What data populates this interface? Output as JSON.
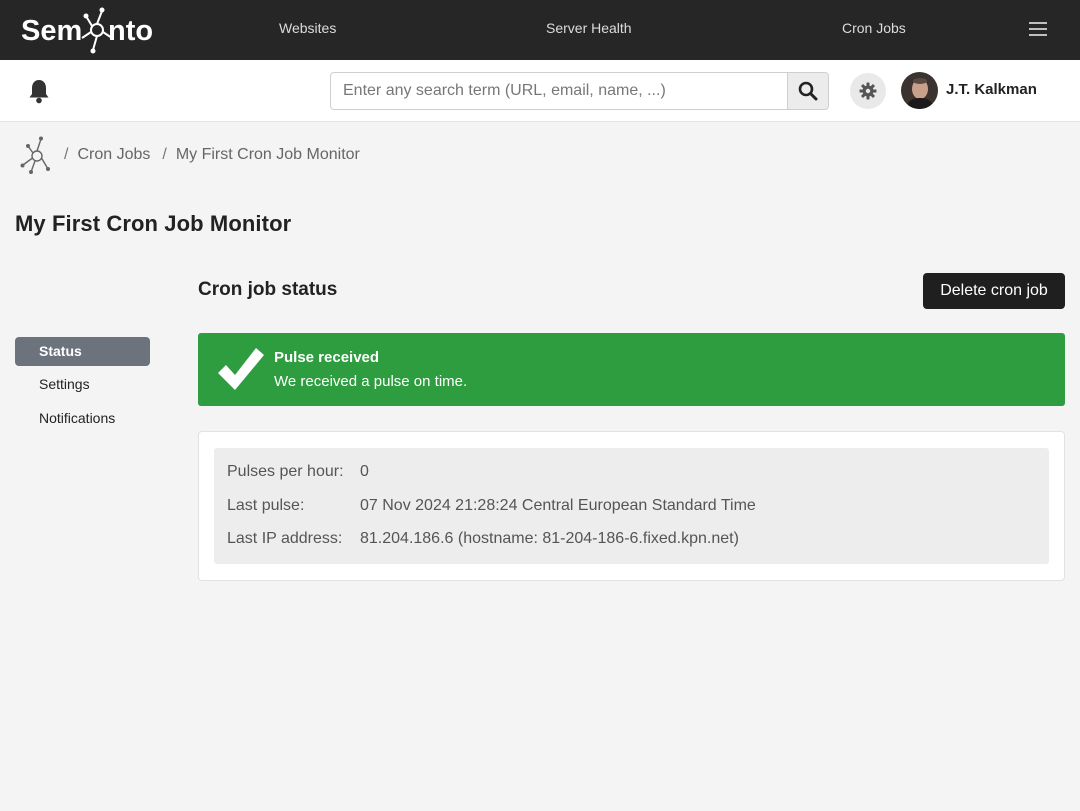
{
  "app": {
    "brand": "Semonto"
  },
  "topnav": {
    "items": [
      {
        "label": "Websites"
      },
      {
        "label": "Server Health"
      },
      {
        "label": "Cron Jobs"
      }
    ]
  },
  "header": {
    "search_placeholder": "Enter any search term (URL, email, name, ...)",
    "search_value": "",
    "user_name": "J.T. Kalkman"
  },
  "breadcrumb": {
    "separator": "/",
    "items": [
      "Cron Jobs",
      "My First Cron Job Monitor"
    ]
  },
  "page": {
    "title": "My First Cron Job Monitor"
  },
  "sidebar": {
    "items": [
      {
        "label": "Status",
        "active": true
      },
      {
        "label": "Settings",
        "active": false
      },
      {
        "label": "Notifications",
        "active": false
      }
    ]
  },
  "main": {
    "section_title": "Cron job status",
    "delete_label": "Delete cron job",
    "alert": {
      "title": "Pulse received",
      "text": "We received a pulse on time.",
      "color": "#2e9d3f",
      "icon": "checkmark-icon"
    },
    "details": [
      {
        "label": "Pulses per hour:",
        "value": "0"
      },
      {
        "label": "Last pulse:",
        "value": "07 Nov 2024 21:28:24 Central European Standard Time"
      },
      {
        "label": "Last IP address:",
        "value": "81.204.186.6 (hostname: 81-204-186-6.fixed.kpn.net)"
      }
    ]
  }
}
